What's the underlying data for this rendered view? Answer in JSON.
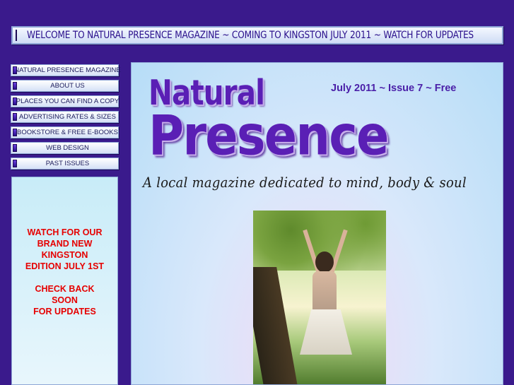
{
  "banner": {
    "text": "WELCOME TO NATURAL PRESENCE MAGAZINE ~ COMING TO KINGSTON JULY 2011 ~ WATCH FOR UPDATES"
  },
  "nav": {
    "items": [
      {
        "label": "NATURAL PRESENCE MAGAZINE"
      },
      {
        "label": "ABOUT US"
      },
      {
        "label": "PLACES YOU CAN FIND A COPY"
      },
      {
        "label": "ADVERTISING RATES & SIZES"
      },
      {
        "label": "BOOKSTORE & FREE E-BOOKS"
      },
      {
        "label": "WEB DESIGN"
      },
      {
        "label": "PAST ISSUES"
      }
    ]
  },
  "side_panel": {
    "message": "WATCH FOR OUR\nBRAND NEW\nKINGSTON\nEDITION JULY 1ST\n\nCHECK BACK\nSOON\nFOR UPDATES",
    "color": "#e60000"
  },
  "masthead": {
    "logo_line1": "Natural",
    "logo_line2": "Presence",
    "issue": "July 2011 ~  Issue 7 ~ Free",
    "tagline": "A local magazine dedicated to mind, body & soul"
  },
  "colors": {
    "background": "#3a1a8c",
    "brand_purple": "#5a1fb5",
    "nav_text": "#1a1a5a"
  }
}
